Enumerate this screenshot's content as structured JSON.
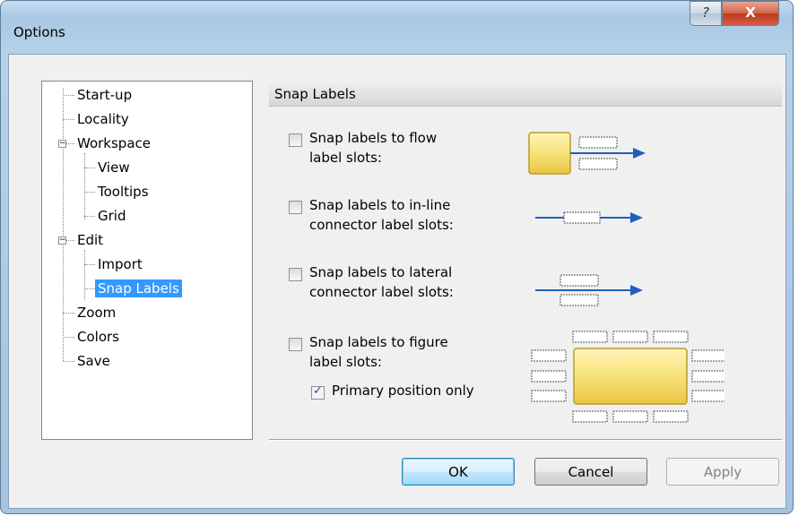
{
  "window": {
    "title": "Options",
    "help_glyph": "?",
    "close_glyph": "X"
  },
  "tree": {
    "items": [
      {
        "label": "Start-up"
      },
      {
        "label": "Locality"
      },
      {
        "label": "Workspace"
      },
      {
        "label": "View"
      },
      {
        "label": "Tooltips"
      },
      {
        "label": "Grid"
      },
      {
        "label": "Edit"
      },
      {
        "label": "Import"
      },
      {
        "label": "Snap Labels"
      },
      {
        "label": "Zoom"
      },
      {
        "label": "Colors"
      },
      {
        "label": "Save"
      }
    ],
    "selected": "Snap Labels"
  },
  "section": {
    "title": "Snap Labels"
  },
  "options": {
    "flow": {
      "line1": "Snap labels to flow",
      "line2": "label slots:",
      "checked": false
    },
    "inline": {
      "line1": "Snap labels to in-line",
      "line2": "connector label slots:",
      "checked": false
    },
    "lateral": {
      "line1": "Snap labels to lateral",
      "line2": "connector label slots:",
      "checked": false
    },
    "figure": {
      "line1": "Snap labels to figure",
      "line2": "label slots:",
      "checked": false
    },
    "primary": {
      "label": "Primary position only",
      "checked": true
    }
  },
  "buttons": {
    "ok": "OK",
    "cancel": "Cancel",
    "apply": "Apply"
  },
  "colors": {
    "accent_blue": "#1f5fbf",
    "figure_yellow": "#f7e27a",
    "selection": "#3399ff"
  }
}
